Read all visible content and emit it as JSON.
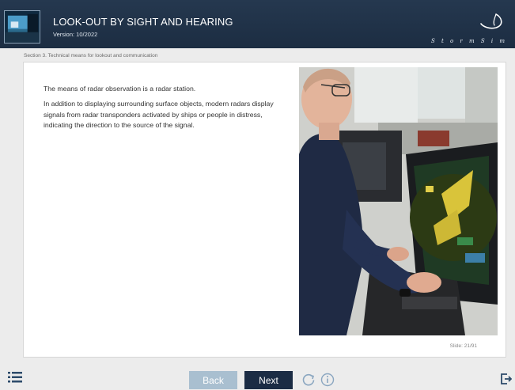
{
  "header": {
    "course_title": "LOOK-OUT BY SIGHT AND HEARING",
    "version": "Version: 10/2022",
    "logo_text": "S t o r m   S i m"
  },
  "breadcrumb": "Section 3. Technical means for lookout and communication",
  "content": {
    "paragraph_1": "The means of radar observation is a radar station.",
    "paragraph_2": "In addition to displaying surrounding surface objects, modern radars display signals from radar transponders activated by ships or people in distress, indicating the direction to the source of the signal."
  },
  "slide_counter": "Slide: 21/91",
  "footer": {
    "back_label": "Back",
    "next_label": "Next",
    "icons": [
      "menu-list-icon",
      "reload-icon",
      "info-icon",
      "exit-icon"
    ]
  },
  "colors": {
    "header_bg": "#1c2d42",
    "next_button": "#1b2c44",
    "back_button": "#a9bfd0",
    "accent": "#2c4a6a"
  }
}
